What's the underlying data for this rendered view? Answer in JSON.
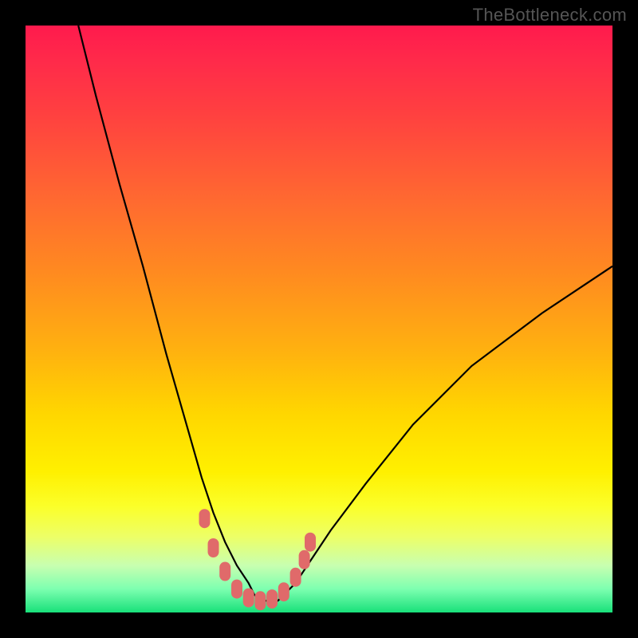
{
  "watermark": "TheBottleneck.com",
  "chart_data": {
    "type": "line",
    "title": "",
    "xlabel": "",
    "ylabel": "",
    "xlim": [
      0,
      100
    ],
    "ylim": [
      0,
      100
    ],
    "series": [
      {
        "name": "bottleneck-curve",
        "x": [
          9,
          12,
          16,
          20,
          24,
          28,
          30,
          32,
          34,
          36,
          38,
          39,
          40,
          41,
          42,
          43,
          44,
          46,
          48,
          52,
          58,
          66,
          76,
          88,
          100
        ],
        "y": [
          100,
          88,
          73,
          59,
          44,
          30,
          23,
          17,
          12,
          8,
          5,
          3,
          2,
          2,
          2,
          2,
          3,
          5,
          8,
          14,
          22,
          32,
          42,
          51,
          59
        ]
      }
    ],
    "markers": {
      "name": "highlight-band",
      "color": "#e06a6a",
      "x": [
        30.5,
        32,
        34,
        36,
        38,
        40,
        42,
        44,
        46,
        47.5,
        48.5
      ],
      "y": [
        16,
        11,
        7,
        4,
        2.5,
        2,
        2.3,
        3.5,
        6,
        9,
        12
      ]
    },
    "background_gradient": {
      "top": "#ff1a4d",
      "mid": "#ffd600",
      "bottom": "#18e07a"
    }
  }
}
